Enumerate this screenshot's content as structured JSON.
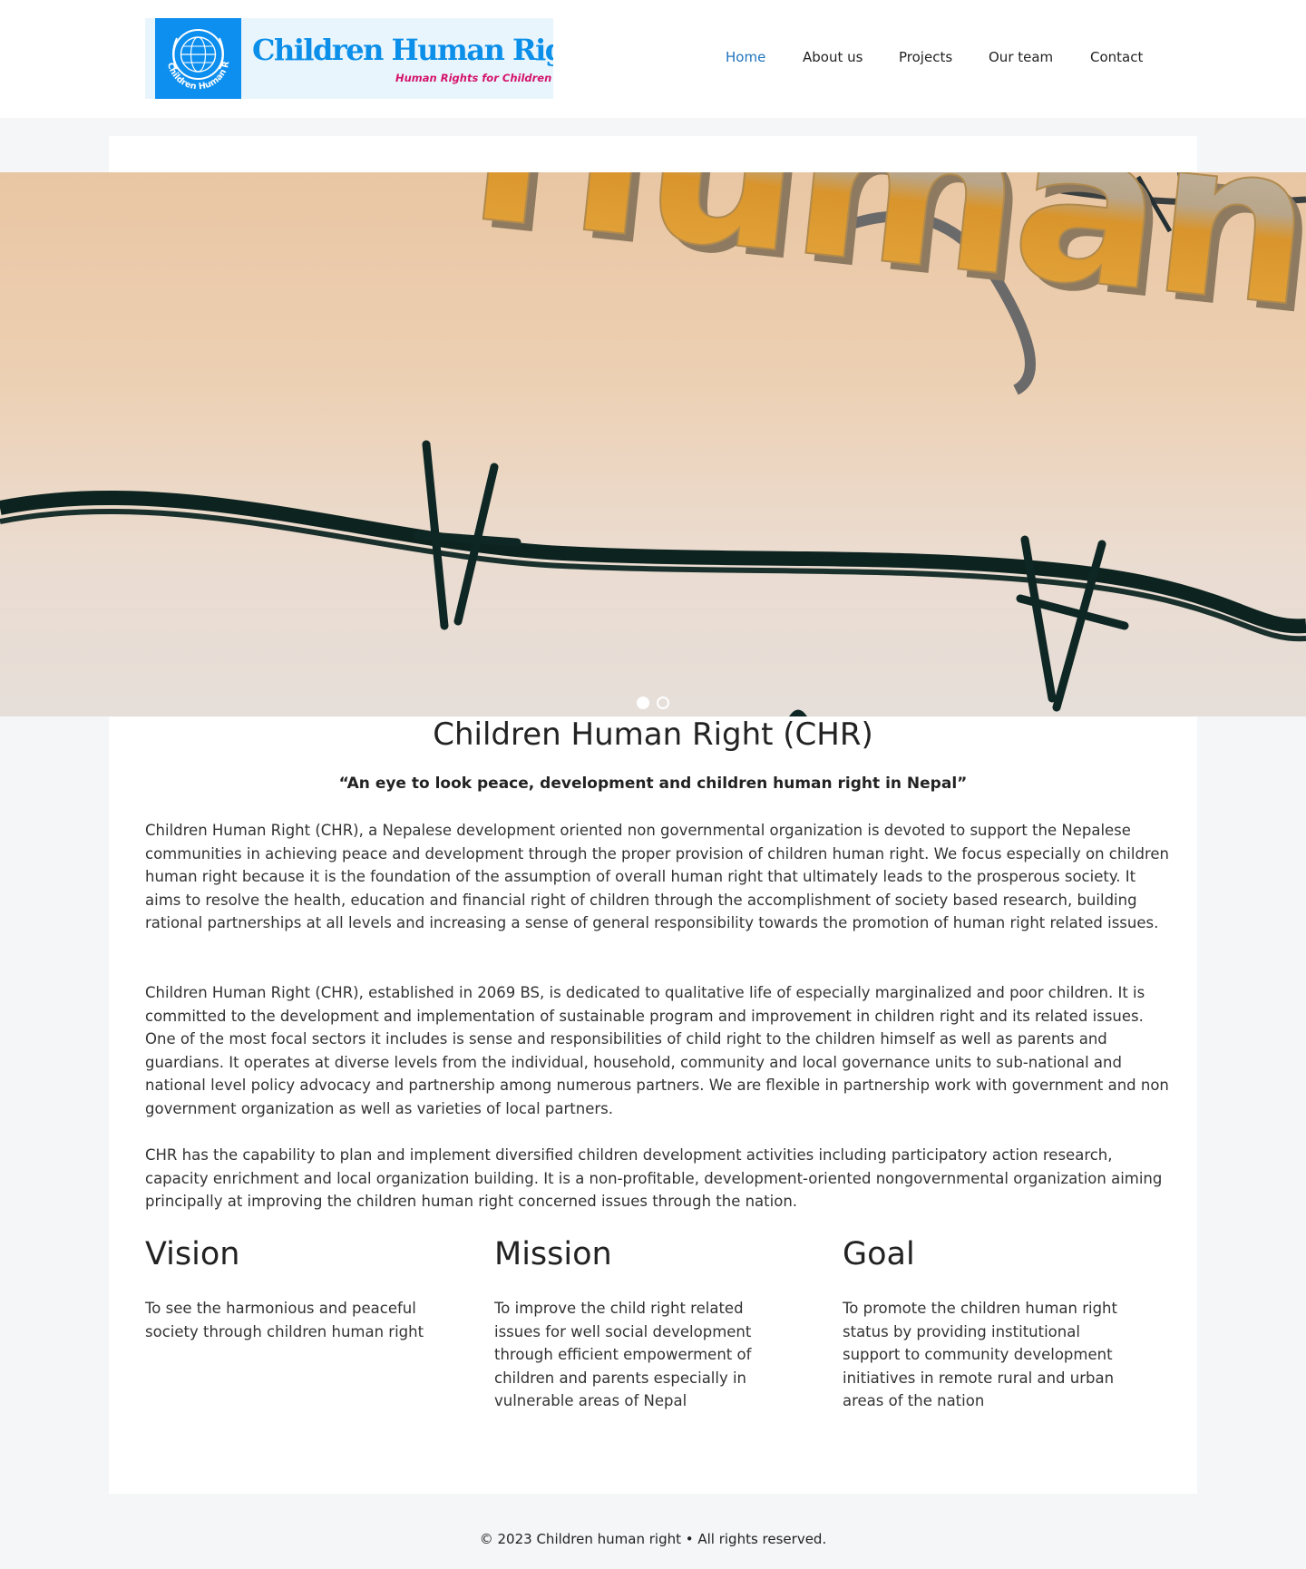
{
  "header": {
    "logo": {
      "title": "Children Human Right",
      "tagline": "Human Rights for Children",
      "emblem_text": "Children Human Right",
      "brand_color": "#0d8ff0",
      "tagline_color": "#d4146c"
    },
    "nav": {
      "active_color": "#1e73be",
      "items": [
        {
          "label": "Home",
          "active": true
        },
        {
          "label": "About us",
          "active": false
        },
        {
          "label": "Projects",
          "active": false
        },
        {
          "label": "Our team",
          "active": false
        },
        {
          "label": "Contact",
          "active": false
        }
      ]
    }
  },
  "hero": {
    "image_text": "Human rights",
    "slides": 2,
    "active_slide": 1
  },
  "main": {
    "title": "Children Human Right (CHR)",
    "slogan": "“An eye to look peace, development and children human right in Nepal”",
    "paragraphs": [
      "Children Human Right (CHR), a Nepalese development oriented non governmental organization is devoted to support the Nepalese communities in achieving peace and development through the proper provision of children human right. We focus especially on children human right because it is the foundation of the assumption of overall human right that ultimately leads to the prosperous society. It aims to resolve the health, education and financial right of children through the accomplishment of society based research, building rational partnerships at all levels and increasing a sense of general responsibility towards the promotion of human right related issues.",
      "Children Human Right (CHR), established in 2069 BS, is dedicated to qualitative life of especially marginalized and poor children. It is committed to the development and implementation of sustainable program and improvement in children right and its related issues. One of the most focal sectors it includes is sense and responsibilities of child right to the children himself as well as parents and guardians. It operates at diverse levels from the individual, household, community and local governance units to sub-national and national level policy advocacy and partnership among numerous partners. We are flexible in partnership work with government and non government organization as well as varieties of local partners.",
      "CHR has the capability to plan and implement diversified children development activities including participatory action research, capacity enrichment and local organization building. It is a non-profitable, development-oriented nongovernmental organization aiming principally at improving the children human right concerned issues through the nation."
    ],
    "columns": [
      {
        "heading": "Vision",
        "text": "To see the harmonious and peaceful society through children human right"
      },
      {
        "heading": "Mission",
        "text": "To improve the child right related issues for well social development through efficient empowerment of children and parents especially in vulnerable areas of Nepal"
      },
      {
        "heading": "Goal",
        "text": "To promote the children human right status by providing institutional support to community development initiatives in remote rural and urban areas of the nation"
      }
    ]
  },
  "footer": {
    "text": "© 2023 Children human right • All rights reserved."
  }
}
